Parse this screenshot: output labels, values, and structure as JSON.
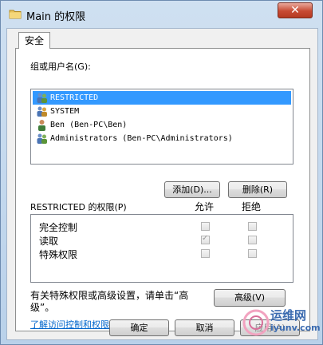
{
  "window": {
    "title": "Main 的权限",
    "close_label": "✕"
  },
  "tab": {
    "label": "安全"
  },
  "group_list": {
    "heading": "组或用户名(G):",
    "items": [
      {
        "label": "RESTRICTED",
        "selected": true
      },
      {
        "label": "SYSTEM",
        "selected": false
      },
      {
        "label": "Ben (Ben-PC\\Ben)",
        "selected": false
      },
      {
        "label": "Administrators (Ben-PC\\Administrators)",
        "selected": false
      }
    ]
  },
  "buttons": {
    "add": "添加(D)...",
    "remove": "删除(R)",
    "advanced": "高级(V)",
    "ok": "确定",
    "cancel": "取消",
    "apply": "应用(A)"
  },
  "permissions": {
    "heading": "RESTRICTED 的权限(P)",
    "allow_col": "允许",
    "deny_col": "拒绝",
    "rows": [
      {
        "label": "完全控制",
        "allow": false,
        "deny": false
      },
      {
        "label": "读取",
        "allow": true,
        "deny": false
      },
      {
        "label": "特殊权限",
        "allow": false,
        "deny": false
      }
    ]
  },
  "info": {
    "line1": "有关特殊权限或高级设置，请单击“高",
    "line2": "级”。"
  },
  "link": {
    "label": "了解访问控制和权限"
  },
  "watermark": {
    "line1": "运维网",
    "line2": "iyunv.com"
  }
}
